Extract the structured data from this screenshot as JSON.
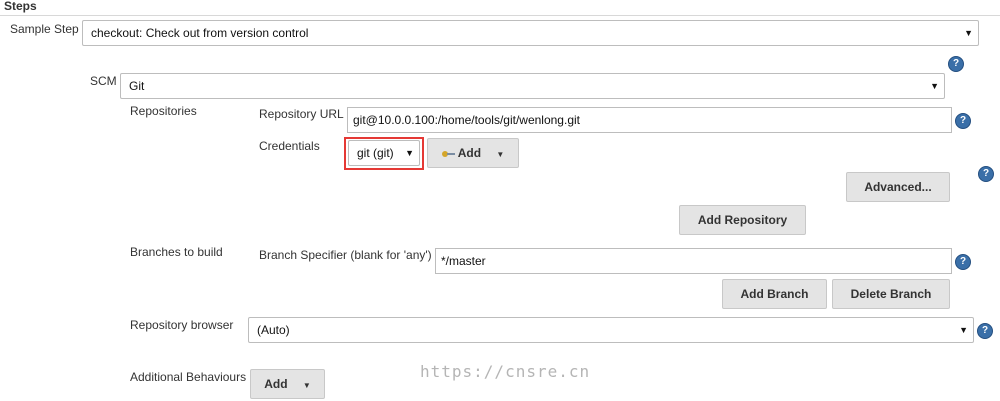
{
  "steps": {
    "header": "Steps",
    "sample_step_label": "Sample Step",
    "sample_step_value": "checkout: Check out from version control"
  },
  "scm": {
    "label": "SCM",
    "value": "Git"
  },
  "repositories": {
    "label": "Repositories",
    "url_label": "Repository URL",
    "url_value": "git@10.0.0.100:/home/tools/git/wenlong.git",
    "credentials_label": "Credentials",
    "credentials_value": "git (git)",
    "add_label": "Add",
    "advanced_label": "Advanced...",
    "add_repository_label": "Add Repository"
  },
  "branches": {
    "label": "Branches to build",
    "specifier_label": "Branch Specifier (blank for 'any')",
    "specifier_value": "*/master",
    "add_branch_label": "Add Branch",
    "delete_branch_label": "Delete Branch"
  },
  "repository_browser": {
    "label": "Repository browser",
    "value": "(Auto)"
  },
  "additional_behaviours": {
    "label": "Additional Behaviours",
    "add_label": "Add"
  },
  "icons": {
    "help": "help-icon",
    "key": "key-icon",
    "dropdown": "chevron-down-icon"
  },
  "colors": {
    "help_icon": "#3a6fa8",
    "highlight_box": "#e53935",
    "button_bg": "#e4e4e4"
  },
  "help_glyph": "?",
  "watermark": "https://cnsre.cn"
}
